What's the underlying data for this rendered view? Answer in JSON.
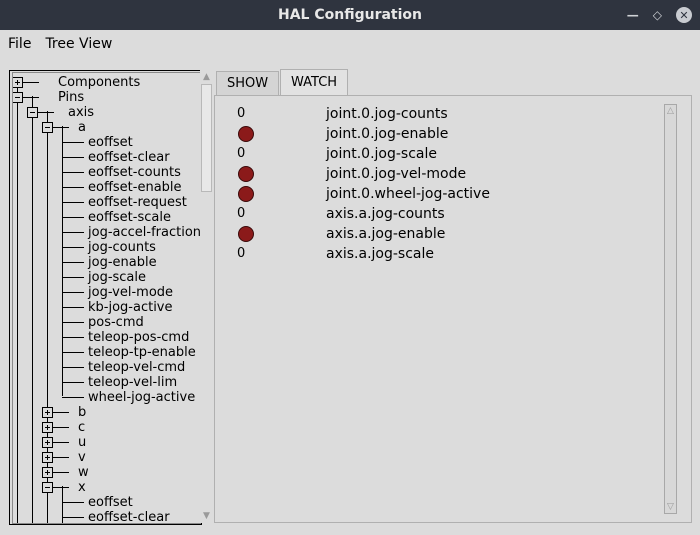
{
  "window": {
    "title": "HAL Configuration",
    "controls": [
      "minimize",
      "restore",
      "close"
    ]
  },
  "menu": [
    "File",
    "Tree View"
  ],
  "tabs": [
    {
      "label": "SHOW",
      "active": false
    },
    {
      "label": "WATCH",
      "active": true
    }
  ],
  "tree": [
    {
      "label": "Components",
      "expander": "plus"
    },
    {
      "label": "Pins",
      "expander": "minus"
    },
    {
      "label": "axis",
      "expander": "minus"
    },
    {
      "label": "a",
      "expander": "minus"
    },
    {
      "label": "eoffset"
    },
    {
      "label": "eoffset-clear"
    },
    {
      "label": "eoffset-counts"
    },
    {
      "label": "eoffset-enable"
    },
    {
      "label": "eoffset-request"
    },
    {
      "label": "eoffset-scale"
    },
    {
      "label": "jog-accel-fraction"
    },
    {
      "label": "jog-counts"
    },
    {
      "label": "jog-enable"
    },
    {
      "label": "jog-scale"
    },
    {
      "label": "jog-vel-mode"
    },
    {
      "label": "kb-jog-active"
    },
    {
      "label": "pos-cmd"
    },
    {
      "label": "teleop-pos-cmd"
    },
    {
      "label": "teleop-tp-enable"
    },
    {
      "label": "teleop-vel-cmd"
    },
    {
      "label": "teleop-vel-lim"
    },
    {
      "label": "wheel-jog-active"
    },
    {
      "label": "b",
      "expander": "plus"
    },
    {
      "label": "c",
      "expander": "plus"
    },
    {
      "label": "u",
      "expander": "plus"
    },
    {
      "label": "v",
      "expander": "plus"
    },
    {
      "label": "w",
      "expander": "plus"
    },
    {
      "label": "x",
      "expander": "minus"
    },
    {
      "label": "eoffset"
    },
    {
      "label": "eoffset-clear"
    }
  ],
  "watch": [
    {
      "type": "value",
      "value": "0",
      "name": "joint.0.jog-counts"
    },
    {
      "type": "led",
      "state": "off",
      "name": "joint.0.jog-enable"
    },
    {
      "type": "value",
      "value": "0",
      "name": "joint.0.jog-scale"
    },
    {
      "type": "led",
      "state": "off",
      "name": "joint.0.jog-vel-mode"
    },
    {
      "type": "led",
      "state": "off",
      "name": "joint.0.wheel-jog-active"
    },
    {
      "type": "value",
      "value": "0",
      "name": "axis.a.jog-counts"
    },
    {
      "type": "led",
      "state": "off",
      "name": "axis.a.jog-enable"
    },
    {
      "type": "value",
      "value": "0",
      "name": "axis.a.jog-scale"
    }
  ],
  "colors": {
    "titlebar": "#2f343f",
    "led_off": "#8b1a1a",
    "background": "#dcdcdc"
  }
}
